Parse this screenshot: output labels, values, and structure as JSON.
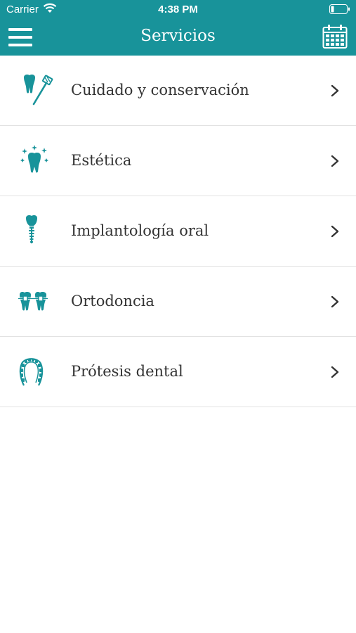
{
  "status_bar": {
    "carrier": "Carrier",
    "time": "4:38 PM"
  },
  "header": {
    "title": "Servicios"
  },
  "services": [
    {
      "label": "Cuidado y conservación",
      "icon": "tooth-toothbrush-icon"
    },
    {
      "label": "Estética",
      "icon": "sparkling-tooth-icon"
    },
    {
      "label": "Implantología oral",
      "icon": "dental-implant-icon"
    },
    {
      "label": "Ortodoncia",
      "icon": "braces-icon"
    },
    {
      "label": "Prótesis dental",
      "icon": "dental-arch-icon"
    }
  ],
  "colors": {
    "primary": "#18939a",
    "text": "#333333",
    "divider": "#e2e2e2"
  }
}
